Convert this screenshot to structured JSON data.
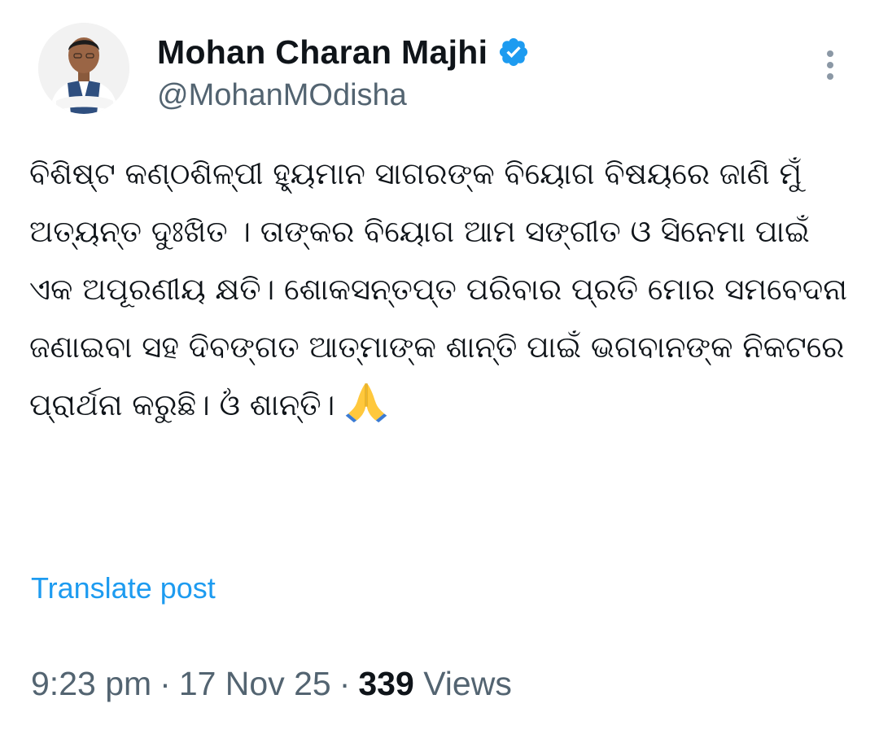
{
  "author": {
    "display_name": "Mohan Charan Majhi",
    "handle": "@MohanMOdisha",
    "verified": true,
    "verified_color": "#1d9bf0"
  },
  "post": {
    "text": "ବିଶିଷ୍ଟ କଣ୍ଠଶିଳ୍ପୀ ହ୍ୟୁମାନ ସାଗରଙ୍କ ବିୟୋଗ ବିଷୟରେ ଜାଣି ମୁଁ ଅତ୍ୟନ୍ତ ଦୁଃଖିତ । ତାଙ୍କର ବିୟୋଗ ଆମ ସଙ୍ଗୀତ ଓ ସିନେମା ପାଇଁ ଏକ ଅପୂରଣୀୟ କ୍ଷତି। ଶୋକସନ୍ତପ୍ତ ପରିବାର ପ୍ରତି ମୋର ସମବେଦନା ଜଣାଇବା ସହ ଦିବଙ୍ଗତ ଆତ୍ମାଙ୍କ ଶାନ୍ତି ପାଇଁ ଭଗବାନଙ୍କ ନିକଟରେ ପ୍ରାର୍ଥନା କରୁଛି। ଓଁ ଶାନ୍ତି।",
    "emoji": "folded-hands",
    "translate_label": "Translate post"
  },
  "meta": {
    "time": "9:23 pm",
    "separator": "·",
    "date": "17 Nov 25",
    "views_count": "339",
    "views_label": "Views"
  },
  "colors": {
    "link": "#1d9bf0",
    "secondary_text": "#536471",
    "primary_text": "#0f1419"
  }
}
